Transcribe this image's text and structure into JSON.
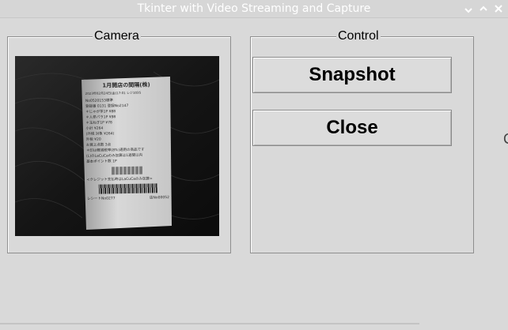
{
  "window": {
    "title": "Tkinter with Video Streaming and Capture",
    "controls": [
      "minimize-icon",
      "maximize-icon",
      "close-icon"
    ]
  },
  "camera_frame": {
    "label": "Camera",
    "receipt": {
      "header": "1月開店の間隔(株)",
      "date_line": "2023年02月24日(金)17:01 レジ1035",
      "lines": [
        "No0520153標準",
        "登録番 0131  登録No2147",
        "＊じゃが芋1P          ¥88",
        "＊人参パラ1P          ¥98",
        "＊玉ねぎ1P            ¥78",
        "小計               ¥264",
        "(外税 対象      ¥264)",
        "外税                ¥20",
        "お買上点数   3点",
        "＊印は軽減税率(8%)適用の商品です",
        "(L)のLaCuCaのみ加算は1週間以内",
        "基本ポイント数            1P"
      ],
      "footer_note": "<クレジット支払時はLaCuCaのみ加算>",
      "register": "レシートNo0277",
      "code": "店No00052"
    }
  },
  "control_frame": {
    "label": "Control",
    "snapshot_label": "Snapshot",
    "close_label": "Close"
  },
  "edge_glyph": "C"
}
